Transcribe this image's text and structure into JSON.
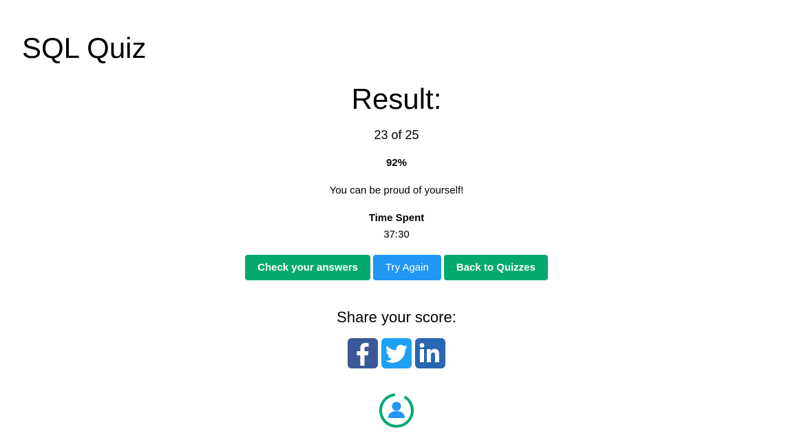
{
  "header": {
    "title": "SQL Quiz"
  },
  "result": {
    "heading": "Result:",
    "score": "23 of 25",
    "percent": "92%",
    "message": "You can be proud of yourself!",
    "time_label": "Time Spent",
    "time_value": "37:30"
  },
  "actions": {
    "check_label": "Check your answers",
    "retry_label": "Try Again",
    "back_label": "Back to Quizzes"
  },
  "share": {
    "label": "Share your score:",
    "networks": [
      "facebook-icon",
      "twitter-icon",
      "linkedin-icon"
    ]
  },
  "colors": {
    "green": "#04aa6d",
    "blue": "#2196f3",
    "facebook": "#3b5998",
    "twitter": "#1da1f2",
    "linkedin": "#2867b2"
  }
}
